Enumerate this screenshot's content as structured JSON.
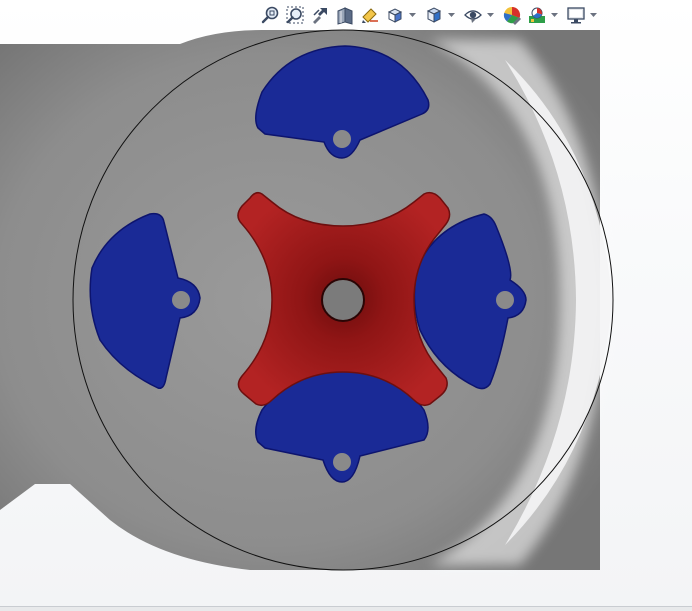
{
  "view": {
    "colors": {
      "background_top": "#ffffff",
      "background_bottom": "#f3f4f6",
      "body_gray": "#8f8f8f",
      "shadow_gray": "#6e6e6e",
      "disc_outline": "#111111",
      "blue_parts": "#1a2a96",
      "blue_edge": "#0d146e",
      "red_part": "#a81e1e",
      "red_edge": "#6d0f0f",
      "hole": "#7b7b7b"
    }
  },
  "toolbar": {
    "buttons": [
      {
        "name": "zoom-to-fit-icon",
        "tooltip": ""
      },
      {
        "name": "zoom-to-area-icon",
        "tooltip": ""
      },
      {
        "name": "previous-view-icon",
        "tooltip": ""
      },
      {
        "name": "section-view-icon",
        "tooltip": ""
      },
      {
        "name": "dynamic-annotation-icon",
        "tooltip": ""
      },
      {
        "name": "view-orientation-icon",
        "tooltip": ""
      },
      {
        "name": "display-style-icon",
        "tooltip": ""
      },
      {
        "name": "hide-show-items-icon",
        "tooltip": ""
      },
      {
        "name": "edit-appearance-icon",
        "tooltip": ""
      },
      {
        "name": "apply-scene-icon",
        "tooltip": ""
      },
      {
        "name": "view-settings-icon",
        "tooltip": ""
      }
    ]
  }
}
